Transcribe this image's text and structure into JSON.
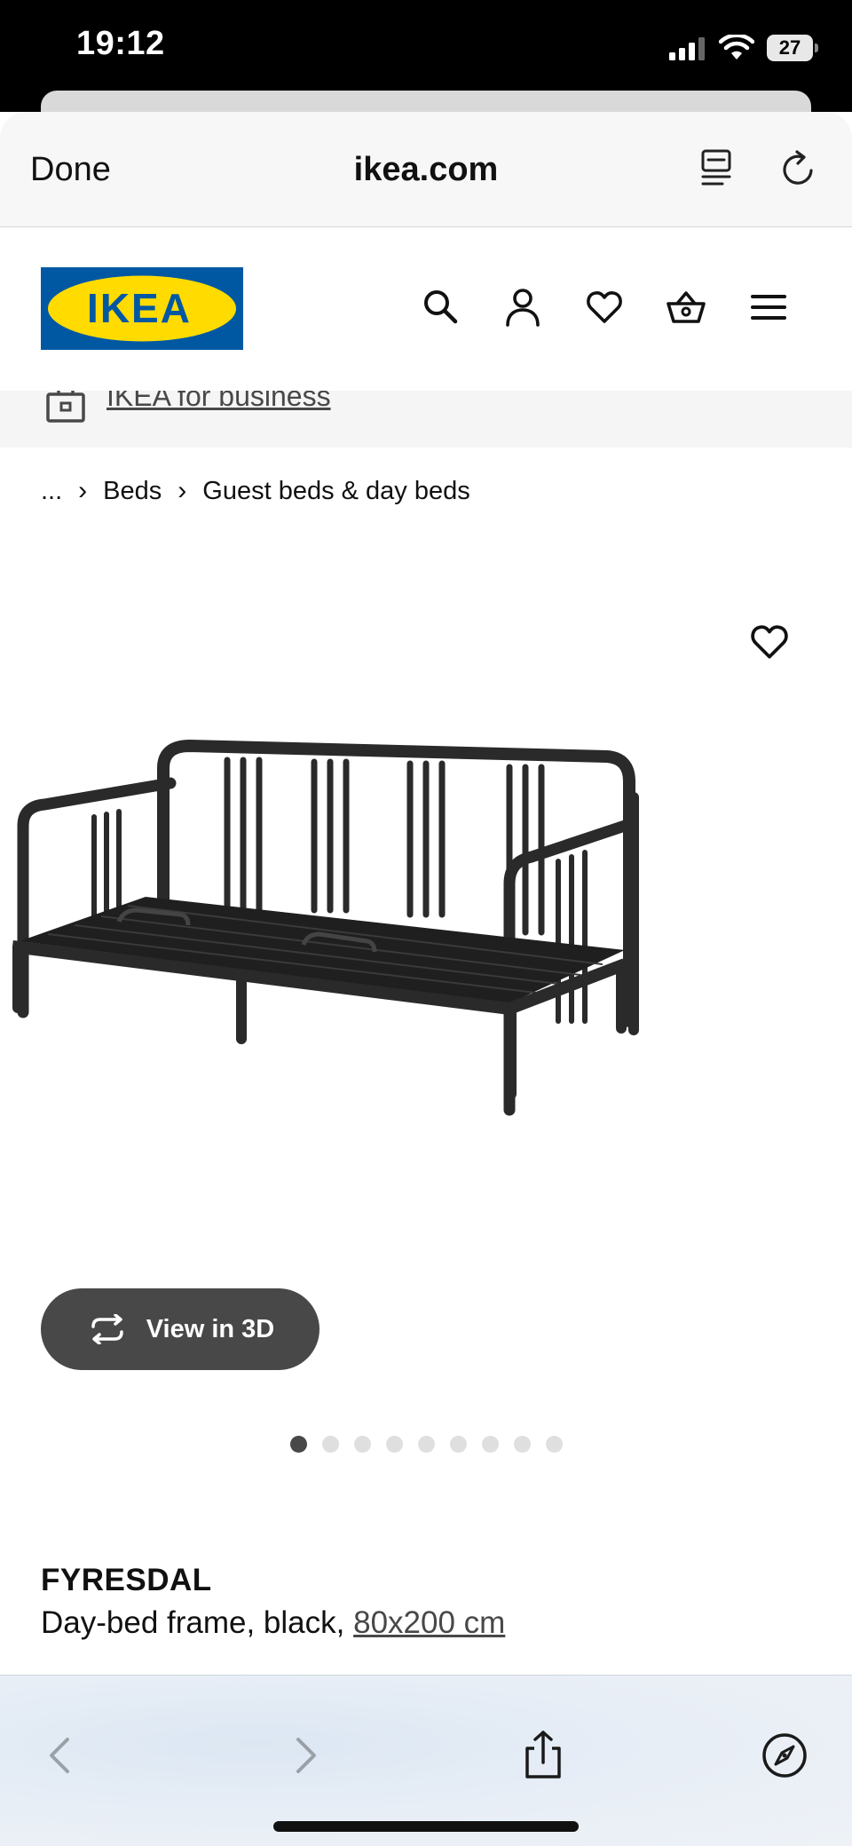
{
  "status": {
    "time": "19:12",
    "battery": "27"
  },
  "browser": {
    "done_label": "Done",
    "url": "ikea.com"
  },
  "header": {
    "logo_text": "IKEA",
    "brand_colors": {
      "blue": "#0058a3",
      "yellow": "#ffdb00"
    },
    "icons": [
      "search-icon",
      "account-icon",
      "favorites-icon",
      "cart-icon",
      "menu-icon"
    ]
  },
  "business_strip": {
    "link": "IKEA for business"
  },
  "breadcrumb": {
    "ellipsis": "...",
    "items": [
      "Beds",
      "Guest beds & day beds"
    ]
  },
  "product": {
    "view3d_label": "View in 3D",
    "image_count": 9,
    "active_image": 1,
    "name": "FYRESDAL",
    "description_prefix": "Day-bed frame, black,",
    "size_link": "80x200 cm"
  },
  "toolbar": {
    "icons": [
      "back-icon",
      "forward-icon",
      "share-icon",
      "compass-icon"
    ]
  }
}
